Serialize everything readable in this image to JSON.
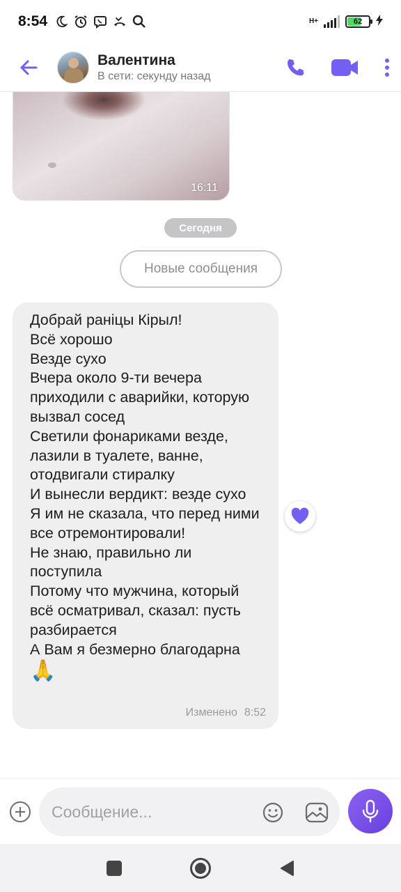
{
  "status_bar": {
    "time": "8:54",
    "network_label": "H+",
    "battery_level": "62",
    "icons": [
      "moon-icon",
      "alarm-icon",
      "viber-icon",
      "missed-call-icon",
      "search-icon",
      "signal-icon",
      "battery-icon",
      "charging-icon"
    ]
  },
  "header": {
    "contact_name": "Валентина",
    "contact_status": "В сети: секунду назад",
    "accent_color": "#7360f2"
  },
  "messages": {
    "photo_time": "16:11",
    "date_badge": "Сегодня",
    "new_messages_label": "Новые сообщения",
    "bubble": {
      "text": "Добрай раніцы Кірыл!\nВсё хорошо\nВезде сухо\nВчера около 9-ти вечера приходили с аварийки, которую вызвал сосед\nСветили фонариками везде, лазили в туалете, ванне, отодвигали стиралку\nИ вынесли вердикт: везде сухо\nЯ им не сказала, что перед ними все отремонтировали!\nНе знаю, правильно ли поступила\nПотому что мужчина, который всё осматривал, сказал: пусть разбирается\nА Вам я безмерно благодарна",
      "emoji": "🙏",
      "edited_label": "Изменено",
      "time": "8:52"
    },
    "reaction": "heart-icon"
  },
  "composer": {
    "placeholder": "Сообщение..."
  }
}
